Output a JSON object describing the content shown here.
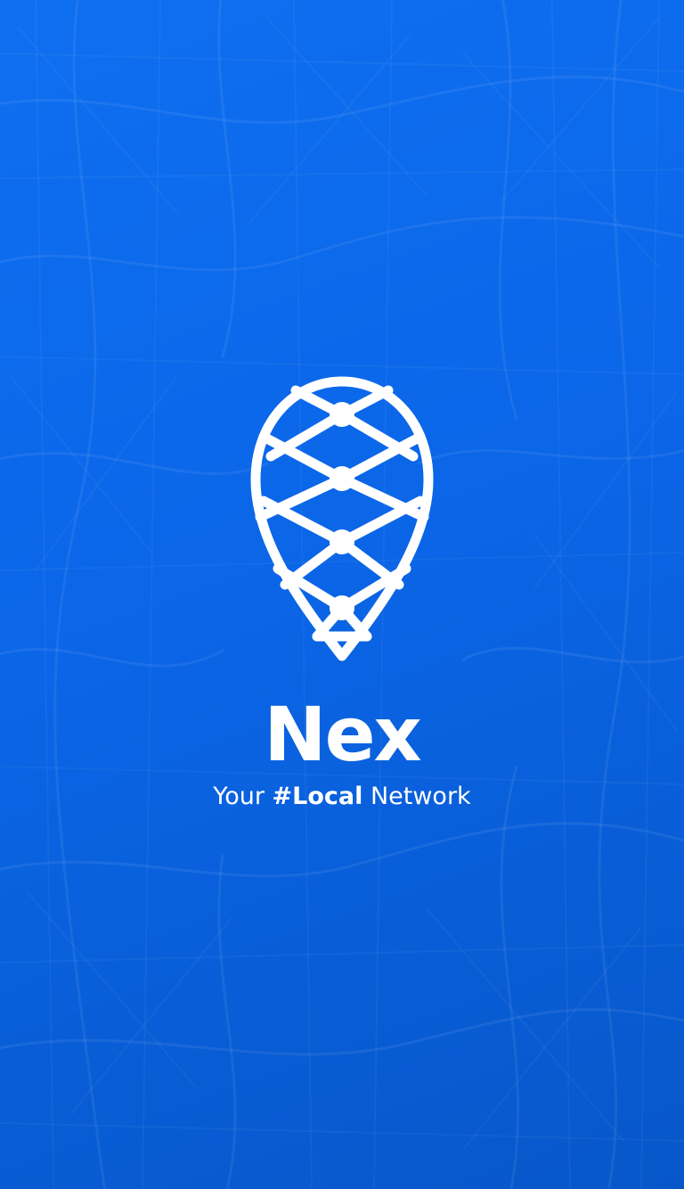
{
  "app": {
    "name": "Nex",
    "tagline": {
      "prefix": "Your ",
      "highlight": "#Local",
      "suffix": " Network"
    }
  },
  "icons": {
    "logo": "map-pin-network-icon",
    "background": "city-map-pattern"
  },
  "colors": {
    "background_top": "#0e6ff0",
    "background_bottom": "#0757c9",
    "foreground": "#ffffff"
  }
}
